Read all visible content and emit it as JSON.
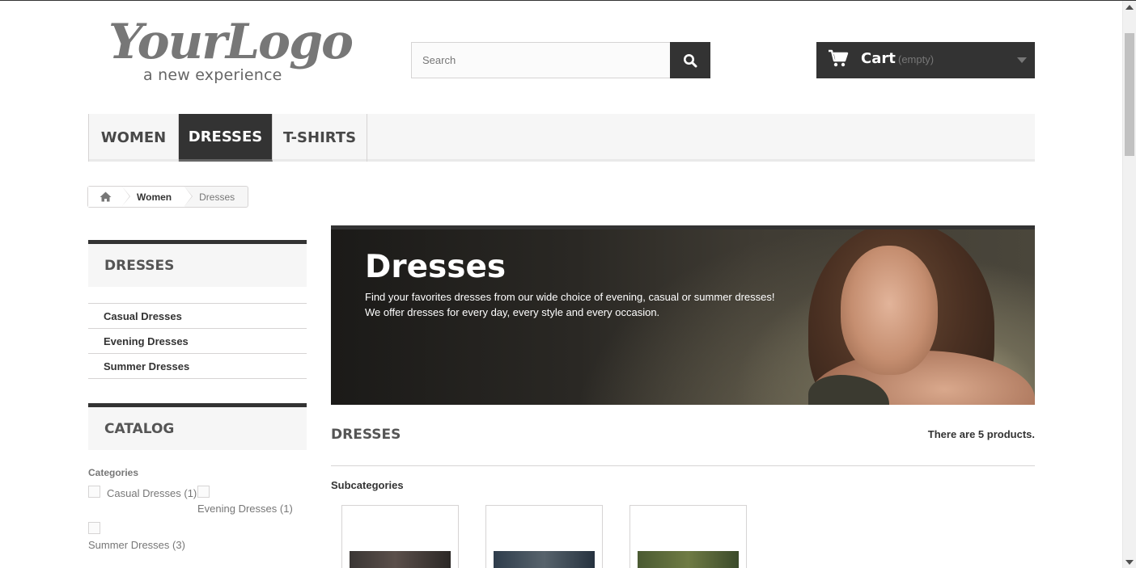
{
  "header": {
    "logo_script": "YourLogo",
    "logo_tagline": "a new experience",
    "search_placeholder": "Search",
    "cart_label": "Cart",
    "cart_status": "(empty)"
  },
  "nav": {
    "tabs": [
      {
        "label": "WOMEN",
        "active": false
      },
      {
        "label": "DRESSES",
        "active": true
      },
      {
        "label": "T-SHIRTS",
        "active": false
      }
    ]
  },
  "breadcrumb": {
    "items": [
      "Women",
      "Dresses"
    ]
  },
  "sidebar": {
    "category_block_title": "DRESSES",
    "category_items": [
      "Casual Dresses",
      "Evening Dresses",
      "Summer Dresses"
    ],
    "catalog_title": "CATALOG",
    "filter_group": "Categories",
    "filters": [
      "Casual Dresses (1)",
      "Evening Dresses (1)",
      "Summer Dresses (3)"
    ]
  },
  "banner": {
    "title": "Dresses",
    "line1": "Find your favorites dresses from our wide choice of evening, casual or summer dresses!",
    "line2": "We offer dresses for every day, every style and every occasion."
  },
  "main": {
    "heading": "DRESSES",
    "product_count": "There are 5 products.",
    "subcategories_title": "Subcategories"
  },
  "colors": {
    "dark": "#333333",
    "panel": "#f6f6f6",
    "border": "#d6d4d4",
    "muted": "#777777"
  }
}
